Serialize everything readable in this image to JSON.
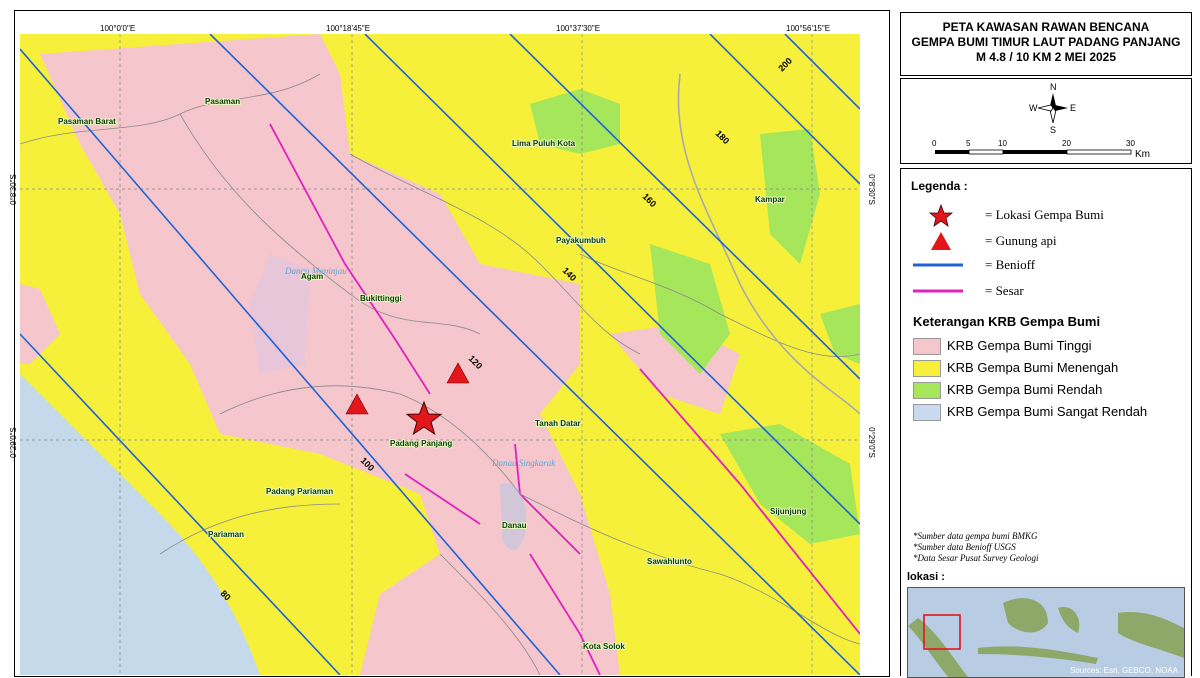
{
  "title": {
    "line1": "PETA KAWASAN RAWAN BENCANA",
    "line2": "GEMPA BUMI TIMUR LAUT PADANG PANJANG",
    "line3": "M 4.8 / 10 KM  2 MEI 2025"
  },
  "graticule": {
    "top_labels": [
      "100°0'0\"E",
      "100°18'45\"E",
      "100°37'30\"E",
      "100°56'15\"E"
    ],
    "left_labels": [
      "0°8'30\"S",
      "0°29'0\"S"
    ],
    "right_labels": [
      "0°8'30\"S",
      "0°29'0\"S"
    ]
  },
  "compass": {
    "n": "N",
    "s": "S",
    "e": "E",
    "w": "W"
  },
  "scalebar": {
    "ticks": [
      "0",
      "5",
      "10",
      "20",
      "30"
    ],
    "unit": "Km"
  },
  "legend": {
    "title": "Legenda :",
    "items": [
      {
        "label": "= Lokasi Gempa Bumi",
        "icon": "star-icon"
      },
      {
        "label": "= Gunung api",
        "icon": "volcano-triangle-icon"
      },
      {
        "label": "= Benioff",
        "icon": "blue-line-icon"
      },
      {
        "label": "= Sesar",
        "icon": "magenta-line-icon"
      }
    ],
    "krb_title": "Keterangan KRB Gempa Bumi",
    "krb_items": [
      {
        "label": "KRB Gempa Bumi Tinggi",
        "color": "#f5c6cc"
      },
      {
        "label": "KRB Gempa Bumi  Menengah",
        "color": "#f6f03a"
      },
      {
        "label": "KRB Gempa Bumi Rendah",
        "color": "#a6e65a"
      },
      {
        "label": "KRB Gempa Bumi Sangat Rendah",
        "color": "#c9d9f0"
      }
    ],
    "notes": [
      "*Sumber data gempa bumi BMKG",
      "*Sumber data Benioff USGS",
      "*Data Sesar Pusat Survey Geologi"
    ],
    "lokasi_label": "lokasi :",
    "inset_credit": "Sources: Esri, GEBCO, NOAA"
  },
  "map": {
    "places": [
      "Pasaman",
      "Pasaman Barat",
      "Lima Puluh Kota",
      "Kampar",
      "Payakumbuh",
      "Agam",
      "Bukittinggi",
      "Padang Panjang",
      "Tanah Datar",
      "Padang Pariaman",
      "Pariaman",
      "Danau",
      "Sijunjung",
      "Sawahlunto",
      "Kota Solok"
    ],
    "water": [
      "Danau Maninjau",
      "Danau Singkarak"
    ],
    "contours": [
      "200",
      "180",
      "160",
      "140",
      "120",
      "100",
      "80"
    ],
    "colors": {
      "high": "#f5c6cc",
      "medium": "#f6f03a",
      "low": "#a6e65a",
      "very_low": "#c9d9f0",
      "sea": "#c4d9ea",
      "benioff": "#1e63d6",
      "fault": "#e020c0",
      "marker": "#e3161b"
    }
  }
}
